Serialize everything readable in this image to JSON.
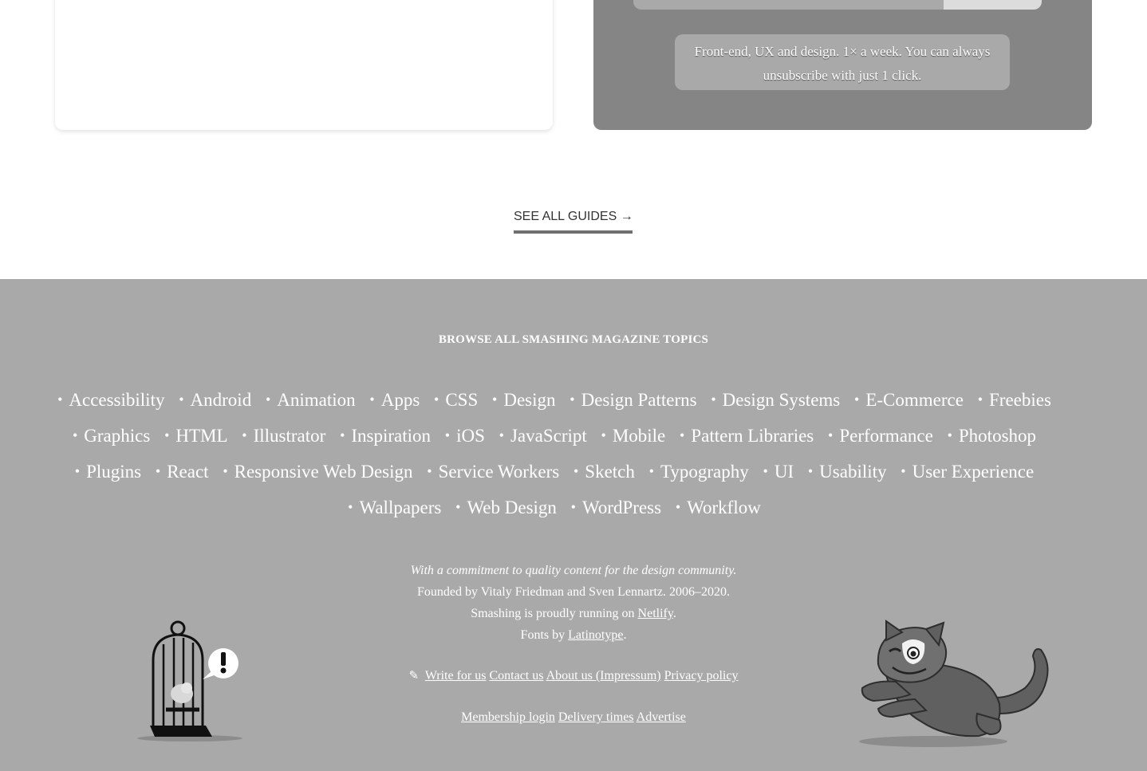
{
  "newsletter": {
    "note": "Front-end, UX and design. 1× a week. You can always unsubscribe with just 1 click."
  },
  "guides": {
    "see_all_label": "SEE ALL GUIDES →"
  },
  "footer": {
    "topics_heading": "BROWSE ALL SMASHING MAGAZINE TOPICS",
    "topics": [
      "Accessibility",
      "Android",
      "Animation",
      "Apps",
      "CSS",
      "Design",
      "Design Patterns",
      "Design Systems",
      "E-Commerce",
      "Freebies",
      "Graphics",
      "HTML",
      "Illustrator",
      "Inspiration",
      "iOS",
      "JavaScript",
      "Mobile",
      "Pattern Libraries",
      "Performance",
      "Photoshop",
      "Plugins",
      "React",
      "Responsive Web Design",
      "Service Workers",
      "Sketch",
      "Typography",
      "UI",
      "Usability",
      "User Experience",
      "Wallpapers",
      "Web Design",
      "WordPress",
      "Workflow"
    ],
    "tagline": "With a commitment to quality content for the design community.",
    "founded": "Founded by Vitaly Friedman and Sven Lennartz. 2006–2020.",
    "hosting_prefix": "Smashing is proudly running on ",
    "hosting_link": "Netlify",
    "fonts_prefix": "Fonts by ",
    "fonts_link": "Latinotype",
    "period": ".",
    "links_row1": [
      "Write for us",
      "Contact us",
      "About us (Impressum)",
      "Privacy policy"
    ],
    "links_row2": [
      "Membership login",
      "Delivery times",
      "Advertise"
    ]
  },
  "icons": {
    "pencil": "pencil-icon",
    "birdcage": "birdcage-illustration",
    "cat": "cat-illustration"
  },
  "colors": {
    "footer_bg": "#a9a9a9",
    "newsletter_bg": "#858585"
  }
}
